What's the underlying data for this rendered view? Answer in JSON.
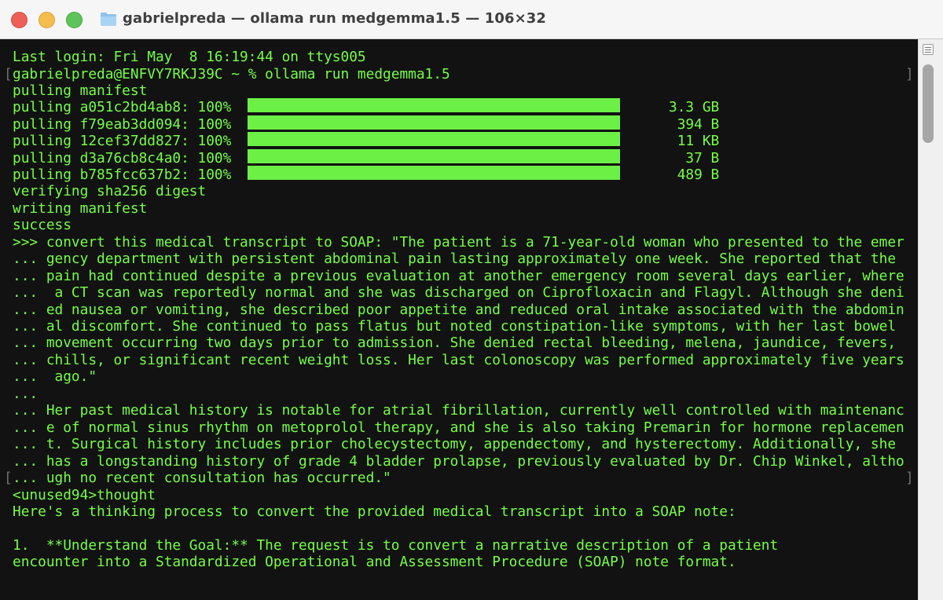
{
  "window": {
    "title": "gabrielpreda — ollama run medgemma1.5"
  },
  "terminal": {
    "lines": [
      "Last login: Fri May  8 16:19:44 on ttys005",
      "gabrielpreda@ENFVY7RKJ39C ~ % ollama run medgemma1.5",
      "pulling manifest",
      "pulling a051c2bd4ab8: 100%                                                    3.3 GB",
      "pulling f79eab3dd094: 100%                                                     394 B",
      "pulling 12cef37dd827: 100%                                                     11 KB",
      "pulling d3a76cb8c4a0: 100%                                                      37 B",
      "pulling b785fcc637b2: 100%                                                     489 B",
      "verifying sha256 digest",
      "writing manifest",
      "success",
      ">>> convert this medical transcript to SOAP: \"The patient is a 71-year-old woman who presented to the emer",
      "... gency department with persistent abdominal pain lasting approximately one week. She reported that the",
      "... pain had continued despite a previous evaluation at another emergency room several days earlier, where",
      "...  a CT scan was reportedly normal and she was discharged on Ciprofloxacin and Flagyl. Although she deni",
      "... ed nausea or vomiting, she described poor appetite and reduced oral intake associated with the abdomin",
      "... al discomfort. She continued to pass flatus but noted constipation-like symptoms, with her last bowel",
      "... movement occurring two days prior to admission. She denied rectal bleeding, melena, jaundice, fevers,",
      "... chills, or significant recent weight loss. Her last colonoscopy was performed approximately five years",
      "...  ago.\"",
      "...",
      "... Her past medical history is notable for atrial fibrillation, currently well controlled with maintenanc",
      "... e of normal sinus rhythm on metoprolol therapy, and she is also taking Premarin for hormone replacemen",
      "... t. Surgical history includes prior cholecystectomy, appendectomy, and hysterectomy. Additionally, she",
      "... has a longstanding history of grade 4 bladder prolapse, previously evaluated by Dr. Chip Winkel, altho",
      "... ugh no recent consultation has occurred.\"",
      "<unused94>thought",
      "Here's a thinking process to convert the provided medical transcript into a SOAP note:",
      "",
      "1.  **Understand the Goal:** The request is to convert a narrative description of a patient",
      "encounter into a Standardized Operational and Assessment Procedure (SOAP) note format."
    ],
    "progress_percent": [
      100,
      100,
      100,
      100,
      100
    ],
    "selection_brackets": {
      "open": "[",
      "close": "]"
    }
  },
  "colors": {
    "text": "#75ff46",
    "background": "#121212",
    "progress_bar": "#6cf046"
  }
}
